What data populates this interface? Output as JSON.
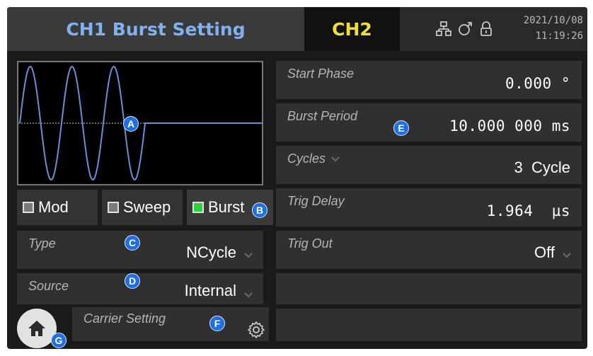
{
  "header": {
    "tab_ch1": "CH1 Burst Setting",
    "tab_ch2": "CH2",
    "date": "2021/10/08",
    "time": "11:19:26",
    "icons": [
      "network-icon",
      "usb-icon",
      "lock-icon"
    ]
  },
  "modes": [
    {
      "label": "Mod",
      "active": false
    },
    {
      "label": "Sweep",
      "active": false
    },
    {
      "label": "Burst",
      "active": true
    }
  ],
  "left_params": {
    "type": {
      "label": "Type",
      "value": "NCycle"
    },
    "source": {
      "label": "Source",
      "value": "Internal"
    }
  },
  "carrier": {
    "label": "Carrier Setting"
  },
  "right_params": [
    {
      "label": "Start Phase",
      "value": "0.000 °"
    },
    {
      "label": "Burst Period",
      "value": "10.000 000 ms"
    },
    {
      "label": "Cycles",
      "value": "3  Cycle"
    },
    {
      "label": "Trig Delay",
      "value": "1.964  µs"
    },
    {
      "label": "Trig Out",
      "value": "Off"
    },
    {
      "label": "",
      "value": ""
    },
    {
      "label": "",
      "value": ""
    }
  ],
  "markers": {
    "a": "A",
    "b": "B",
    "c": "C",
    "d": "D",
    "e": "E",
    "f": "F",
    "g": "G"
  },
  "colors": {
    "ch1": "#7fb2ef",
    "ch2": "#f2df35",
    "burst_active": "#2bd03a",
    "waveform": "#6b8fd6",
    "marker": "#1f6fe0"
  },
  "waveform": {
    "cycles": 3
  }
}
